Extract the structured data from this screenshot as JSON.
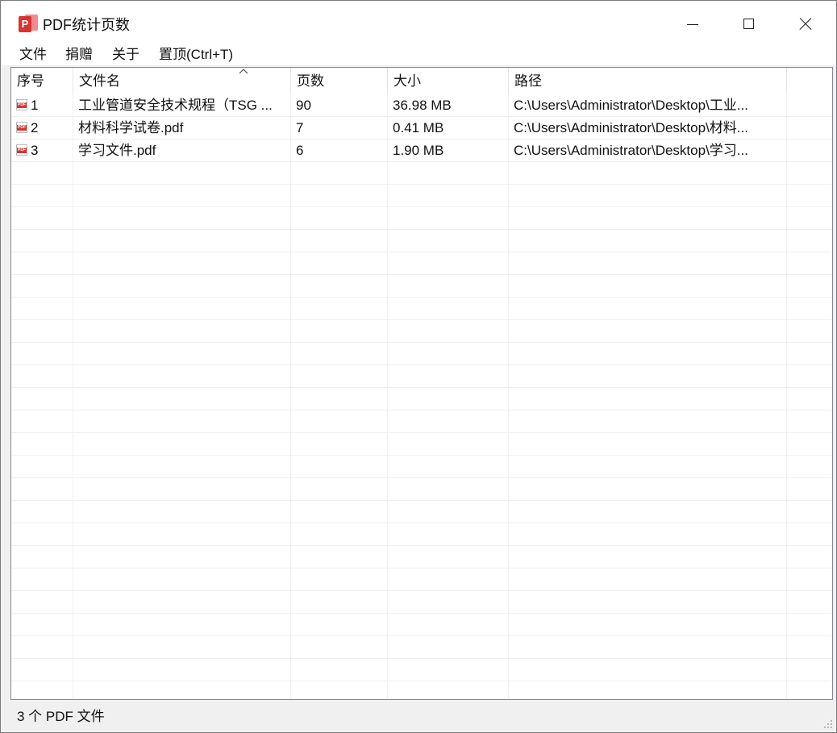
{
  "window": {
    "title": "PDF统计页数",
    "app_icon_letter": "P",
    "accent_color": "#d83434"
  },
  "menu": {
    "items": [
      "文件",
      "捐赠",
      "关于",
      "置顶(Ctrl+T)"
    ]
  },
  "table": {
    "columns": [
      "序号",
      "文件名",
      "页数",
      "大小",
      "路径"
    ],
    "sort_column": "文件名",
    "sort_direction": "ascending",
    "rows": [
      {
        "icon": "pdf-file-icon",
        "index": "1",
        "name": "工业管道安全技术规程（TSG ...",
        "pages": "90",
        "size": "36.98 MB",
        "path": "C:\\Users\\Administrator\\Desktop\\工业..."
      },
      {
        "icon": "pdf-file-icon",
        "index": "2",
        "name": "材料科学试卷.pdf",
        "pages": "7",
        "size": "0.41 MB",
        "path": "C:\\Users\\Administrator\\Desktop\\材料..."
      },
      {
        "icon": "pdf-file-icon",
        "index": "3",
        "name": "学习文件.pdf",
        "pages": "6",
        "size": "1.90 MB",
        "path": "C:\\Users\\Administrator\\Desktop\\学习..."
      }
    ]
  },
  "status": {
    "text": "3 个 PDF 文件"
  }
}
